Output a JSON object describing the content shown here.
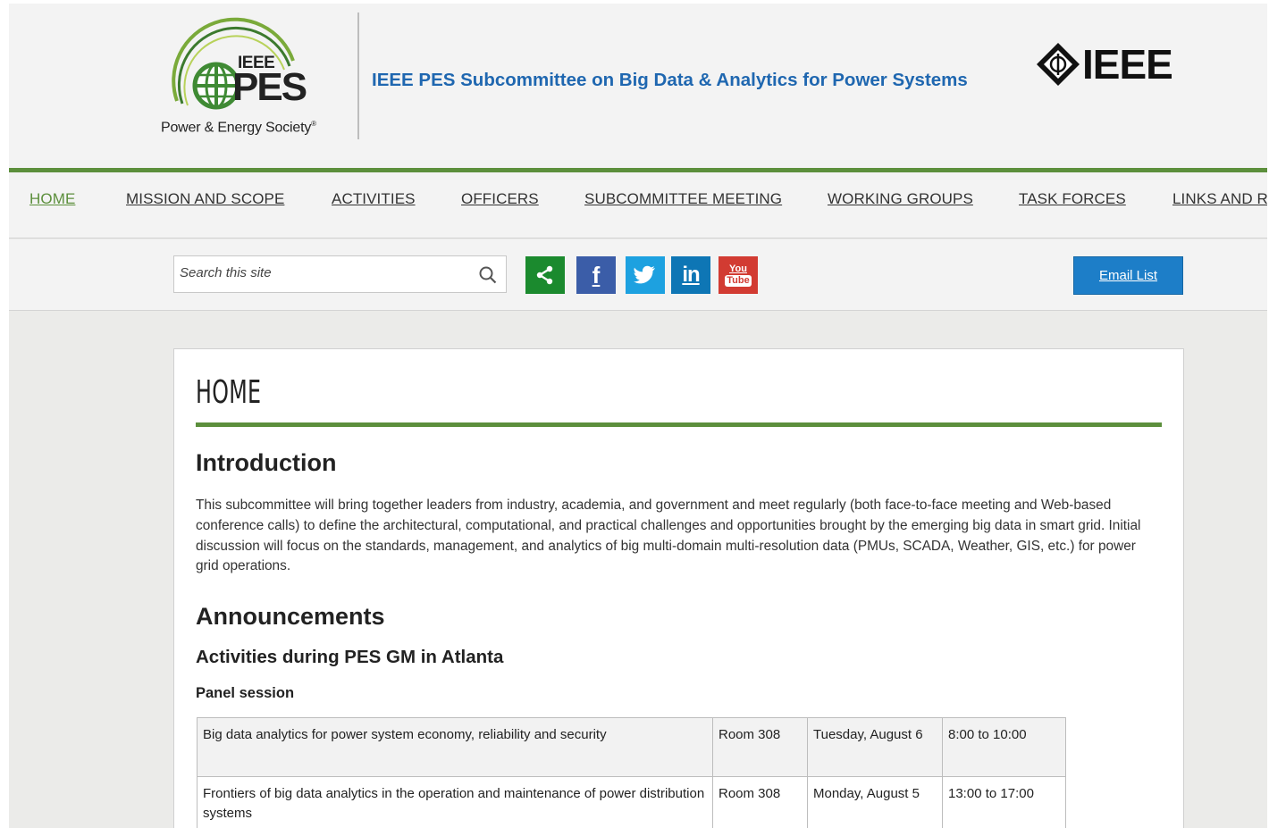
{
  "header": {
    "pes_logo": {
      "top_word": "IEEE",
      "main_word": "PES",
      "caption": "Power & Energy Society",
      "caption_mark": "®"
    },
    "site_title": "IEEE PES Subcommittee on Big Data & Analytics for Power Systems",
    "ieee_brand": "IEEE"
  },
  "nav": {
    "items": [
      {
        "label": "HOME",
        "active": true
      },
      {
        "label": "MISSION AND SCOPE"
      },
      {
        "label": "ACTIVITIES"
      },
      {
        "label": "OFFICERS"
      },
      {
        "label": "SUBCOMMITTEE MEETING"
      },
      {
        "label": "WORKING GROUPS"
      },
      {
        "label": "TASK FORCES"
      },
      {
        "label": "LINKS AND R"
      }
    ]
  },
  "toolbar": {
    "search": {
      "placeholder": "Search this site"
    },
    "social": [
      {
        "name": "share",
        "color": "#1b8a2e"
      },
      {
        "name": "facebook",
        "glyph": "f",
        "color": "#3b5da8"
      },
      {
        "name": "twitter",
        "color": "#1da1e0"
      },
      {
        "name": "linkedin",
        "glyph": "in",
        "color": "#0e76b5"
      },
      {
        "name": "youtube",
        "glyph_top": "You",
        "glyph_bottom": "Tube",
        "color": "#d23b32"
      }
    ],
    "email_label": "Email List"
  },
  "content": {
    "page_title": "HOME",
    "intro_heading": "Introduction",
    "intro_text": "This subcommittee will bring together leaders from industry, academia, and government and meet regularly (both face-to-face meeting and Web-based conference calls) to define the architectural, computational, and practical challenges and opportunities brought by the emerging big data in smart grid. Initial discussion will focus on the standards, management, and analytics of big multi-domain multi-resolution data (PMUs, SCADA, Weather, GIS, etc.) for power grid operations.",
    "announcements_heading": "Announcements",
    "activities_heading": "Activities during PES GM in Atlanta",
    "panel_heading": "Panel session",
    "sessions": [
      {
        "title": "Big data analytics for power system economy, reliability and security",
        "room": "Room 308",
        "date": "Tuesday, August 6",
        "time": "8:00 to 10:00"
      },
      {
        "title": "Frontiers of big data analytics in the operation and maintenance of power distribution systems",
        "room": "Room 308",
        "date": "Monday, August 5",
        "time": "13:00 to 17:00"
      }
    ]
  },
  "colors": {
    "accent_green": "#5c8f3c",
    "title_blue": "#1f67b0",
    "email_blue": "#1d7ec8"
  }
}
